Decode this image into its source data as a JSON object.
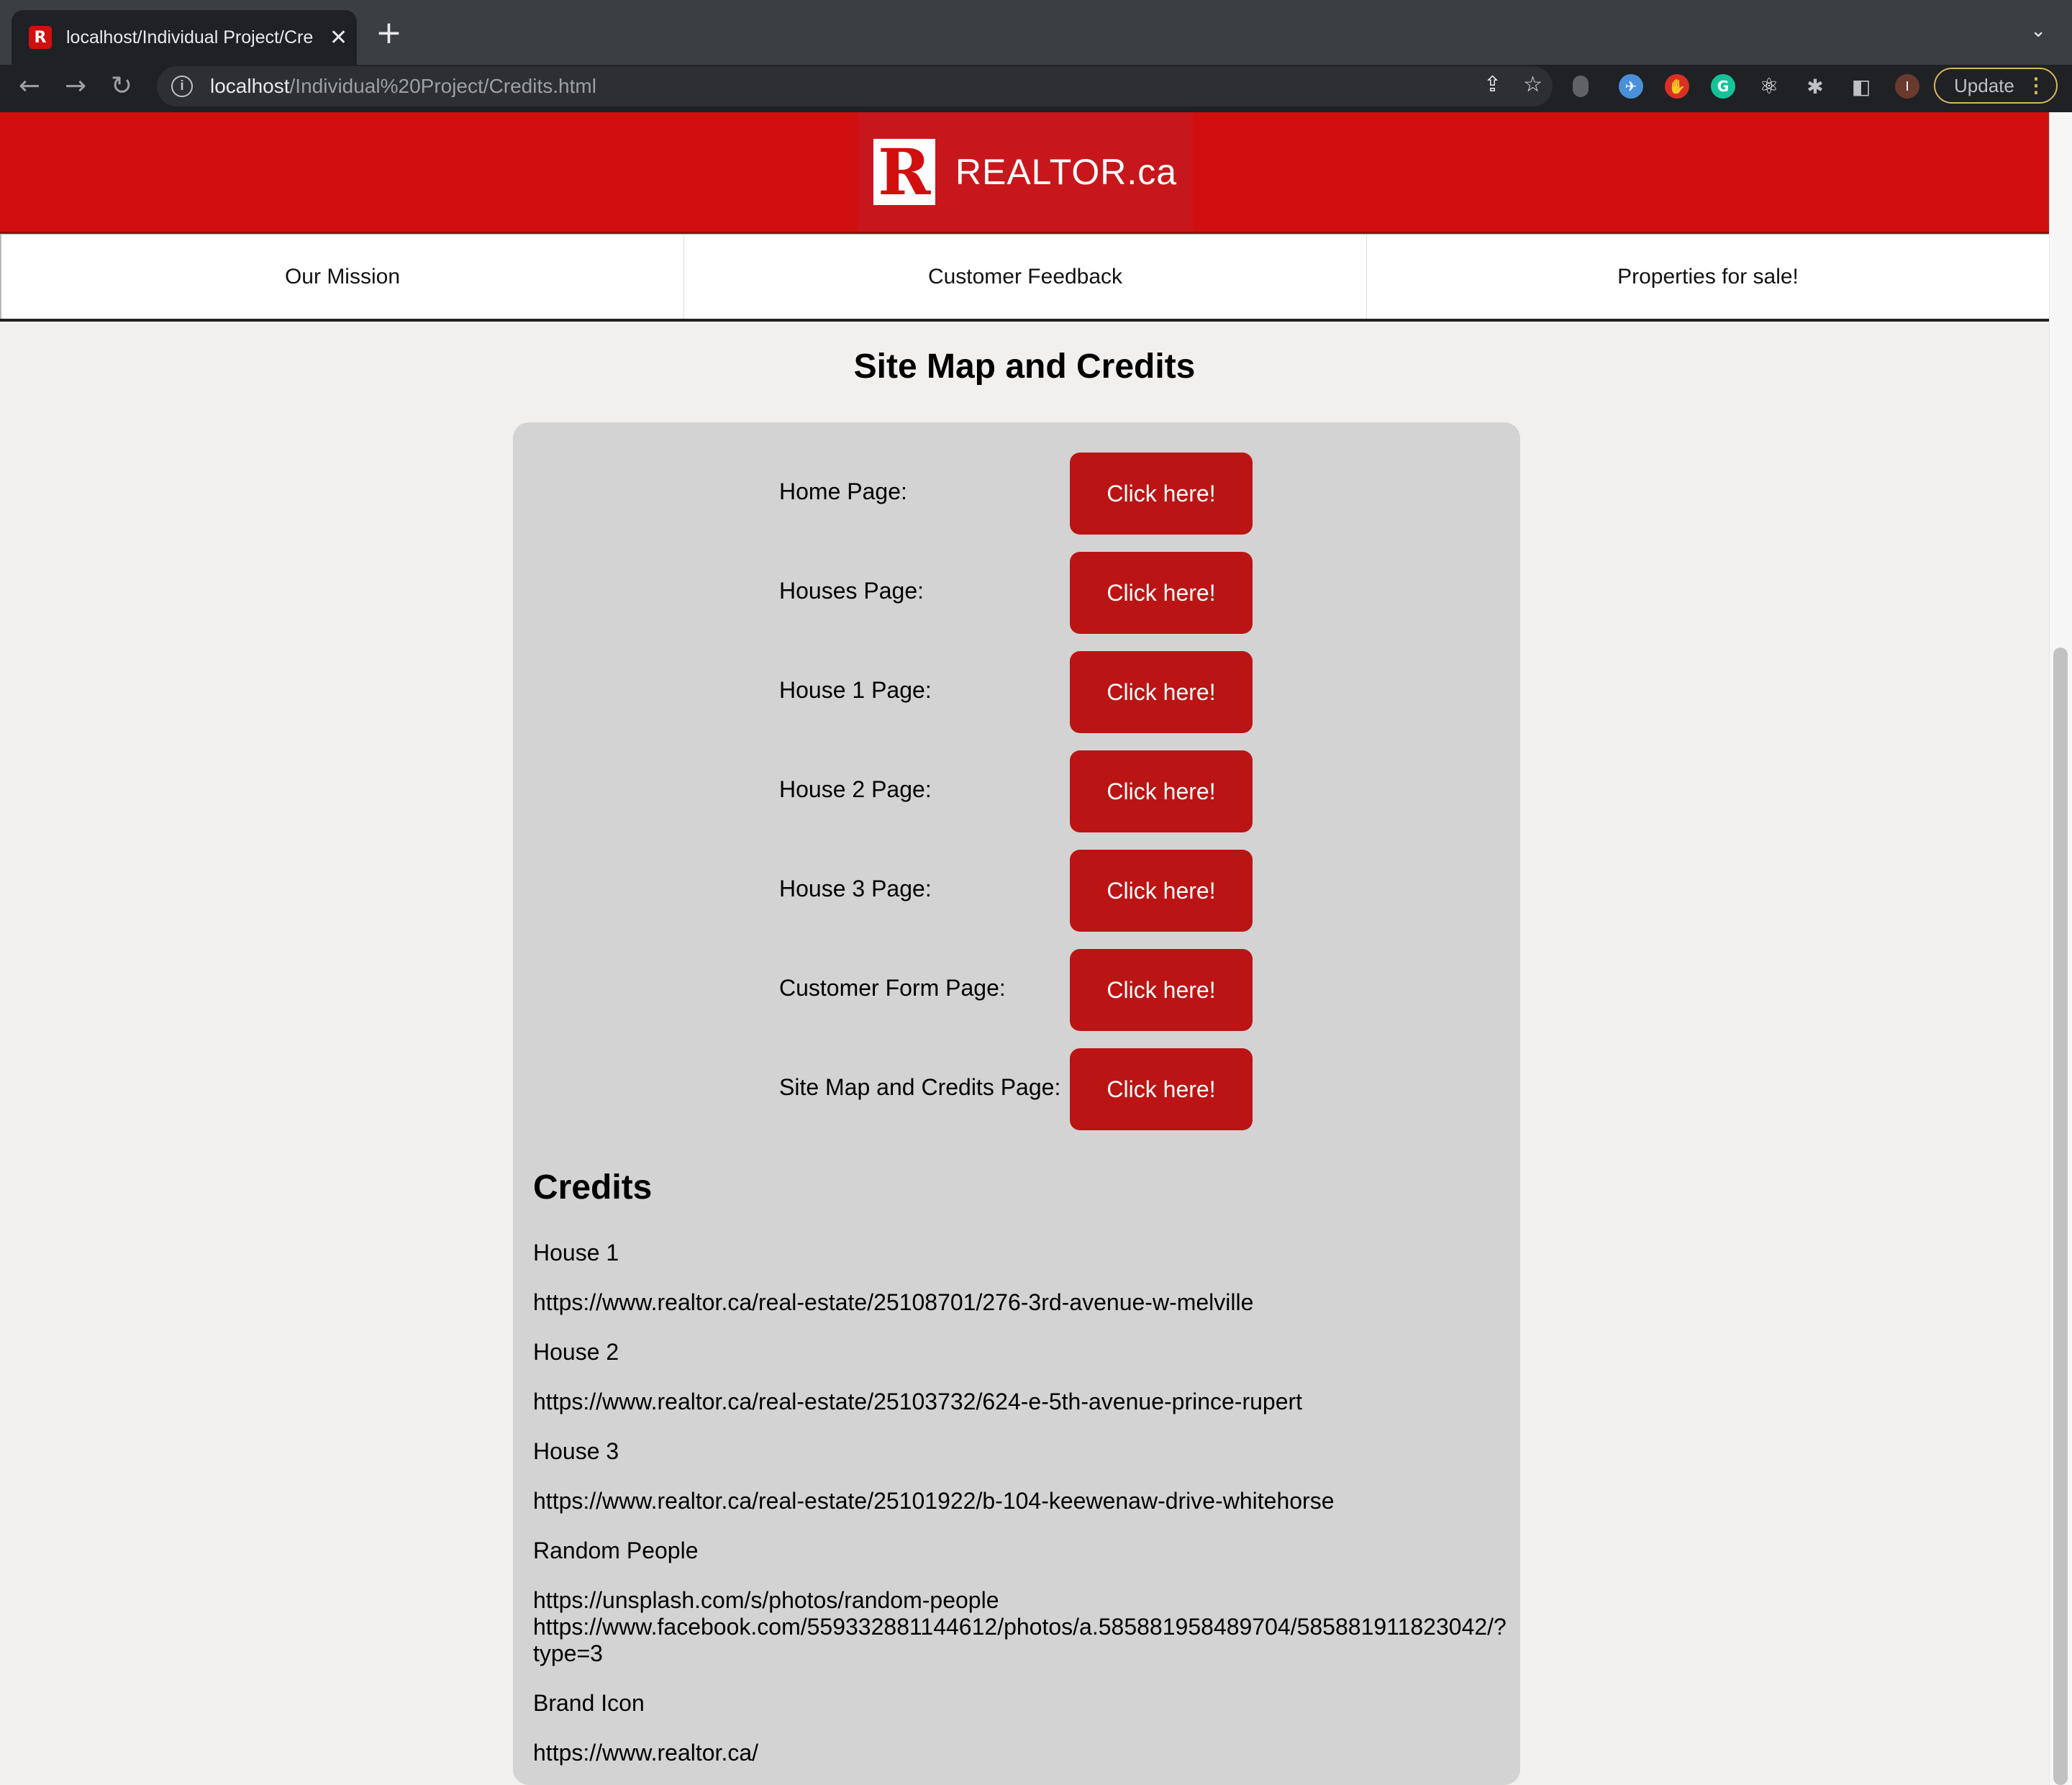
{
  "browser": {
    "tab_title": "localhost/Individual Project/Cre",
    "favicon_letter": "R",
    "url_host": "localhost",
    "url_path": "/Individual%20Project/Credits.html",
    "update_label": "Update",
    "profile_initial": "I"
  },
  "header": {
    "logo_mark": "R",
    "logo_text": "REALTOR.ca"
  },
  "nav": {
    "items": [
      {
        "label": "Our Mission"
      },
      {
        "label": "Customer Feedback"
      },
      {
        "label": "Properties for sale!"
      }
    ]
  },
  "page": {
    "title": "Site Map and Credits"
  },
  "sitemap": {
    "button_label": "Click here!",
    "rows": [
      {
        "label": "Home Page:"
      },
      {
        "label": "Houses Page:"
      },
      {
        "label": "House 1 Page:"
      },
      {
        "label": "House 2 Page:"
      },
      {
        "label": "House 3 Page:"
      },
      {
        "label": "Customer Form Page:"
      },
      {
        "label": "Site Map and Credits Page:"
      }
    ]
  },
  "credits": {
    "title": "Credits",
    "entries": [
      {
        "text": "House 1"
      },
      {
        "text": "https://www.realtor.ca/real-estate/25108701/276-3rd-avenue-w-melville"
      },
      {
        "text": "House 2"
      },
      {
        "text": "https://www.realtor.ca/real-estate/25103732/624-e-5th-avenue-prince-rupert"
      },
      {
        "text": "House 3"
      },
      {
        "text": "https://www.realtor.ca/real-estate/25101922/b-104-keewenaw-drive-whitehorse"
      },
      {
        "text": "Random People"
      },
      {
        "text": "https://unsplash.com/s/photos/random-people"
      },
      {
        "text": "https://www.facebook.com/559332881144612/photos/a.585881958489704/585881911823042/?"
      },
      {
        "text": "type=3"
      },
      {
        "text": "Brand Icon"
      },
      {
        "text": "https://www.realtor.ca/"
      }
    ]
  },
  "colors": {
    "brand_red": "#d20f0f",
    "button_red": "#bb1414",
    "panel_gray": "#d3d3d3",
    "page_bg": "#f2efef"
  }
}
